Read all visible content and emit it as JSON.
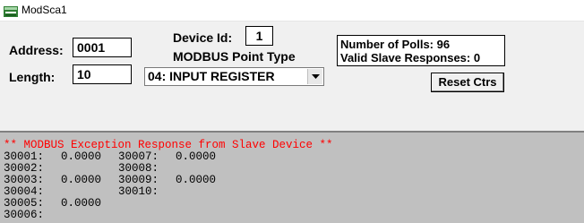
{
  "window": {
    "title": "ModSca1"
  },
  "form": {
    "address_label": "Address:",
    "address_value": "0001",
    "length_label": "Length:",
    "length_value": "10",
    "device_id_label": "Device Id:",
    "device_id_value": "1",
    "point_type_label": "MODBUS Point Type",
    "point_type_value": "04: INPUT REGISTER"
  },
  "stats": {
    "polls": "Number of Polls: 96",
    "responses": "Valid Slave Responses: 0"
  },
  "buttons": {
    "reset_label": "Reset Ctrs"
  },
  "data_view": {
    "exception": "** MODBUS Exception Response from Slave Device **",
    "registers": [
      {
        "label": "30001:",
        "value": "0.0000"
      },
      {
        "label": "30002:",
        "value": ""
      },
      {
        "label": "30003:",
        "value": "0.0000"
      },
      {
        "label": "30004:",
        "value": ""
      },
      {
        "label": "30005:",
        "value": "0.0000"
      },
      {
        "label": "30006:",
        "value": ""
      },
      {
        "label": "30007:",
        "value": "0.0000"
      },
      {
        "label": "30008:",
        "value": ""
      },
      {
        "label": "30009:",
        "value": "0.0000"
      },
      {
        "label": "30010:",
        "value": ""
      }
    ]
  },
  "colors": {
    "exception_text": "#ff0000",
    "data_background": "#c0c0c0",
    "window_background": "#f0f0f0"
  },
  "icons": [
    "app-icon",
    "dropdown-arrow-icon"
  ]
}
